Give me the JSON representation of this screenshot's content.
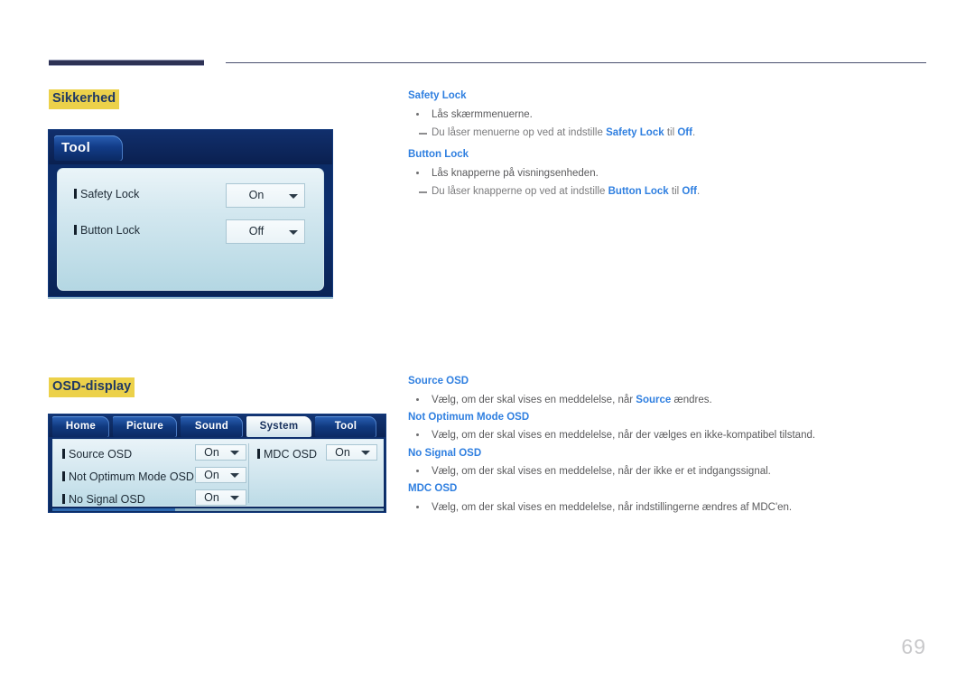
{
  "page": {
    "number": "69",
    "accent_heading_bg": "#ecd14a",
    "accent_heading_fg": "#1f3864",
    "accent_term_color": "#2f7fe0",
    "rule_color": "#2e3255"
  },
  "sections": [
    {
      "heading": "Sikkerhed",
      "osd": {
        "type": "tool-dialog",
        "title_tab": "Tool",
        "rows": [
          {
            "label": "Safety Lock",
            "value": "On"
          },
          {
            "label": "Button Lock",
            "value": "Off"
          }
        ]
      },
      "entries": [
        {
          "term": "Safety Lock",
          "bullet": "Lås skærmmenuerne.",
          "note_pre": "Du låser menuerne op ved at indstille ",
          "note_b1": "Safety Lock",
          "note_mid": " til ",
          "note_b2": "Off",
          "note_post": "."
        },
        {
          "term": "Button Lock",
          "bullet": "Lås knapperne på visningsenheden.",
          "note_pre": "Du låser knapperne op ved at indstille ",
          "note_b1": "Button Lock",
          "note_mid": " til ",
          "note_b2": "Off",
          "note_post": "."
        }
      ]
    },
    {
      "heading": "OSD-display",
      "osd": {
        "type": "system-tabbed-dialog",
        "tabs": [
          {
            "label": "Home",
            "active": false
          },
          {
            "label": "Picture",
            "active": false
          },
          {
            "label": "Sound",
            "active": false
          },
          {
            "label": "System",
            "active": true
          },
          {
            "label": "Tool",
            "active": false
          }
        ],
        "left_rows": [
          {
            "label": "Source OSD",
            "value": "On"
          },
          {
            "label": "Not Optimum Mode OSD",
            "value": "On"
          },
          {
            "label": "No Signal OSD",
            "value": "On"
          }
        ],
        "right_rows": [
          {
            "label": "MDC OSD",
            "value": "On"
          }
        ]
      },
      "entries": [
        {
          "term": "Source OSD",
          "bullet_pre": "Vælg, om der skal vises en meddelelse, når ",
          "bullet_b": "Source",
          "bullet_post": " ændres."
        },
        {
          "term": "Not Optimum Mode OSD",
          "bullet_pre": "Vælg, om der skal vises en meddelelse, når der vælges en ikke-kompatibel tilstand.",
          "bullet_b": "",
          "bullet_post": ""
        },
        {
          "term": "No Signal OSD",
          "bullet_pre": "Vælg, om der skal vises en meddelelse, når der ikke er et indgangssignal.",
          "bullet_b": "",
          "bullet_post": ""
        },
        {
          "term": "MDC OSD",
          "bullet_pre": "Vælg, om der skal vises en meddelelse, når indstillingerne ændres af MDC'en.",
          "bullet_b": "",
          "bullet_post": ""
        }
      ]
    }
  ]
}
